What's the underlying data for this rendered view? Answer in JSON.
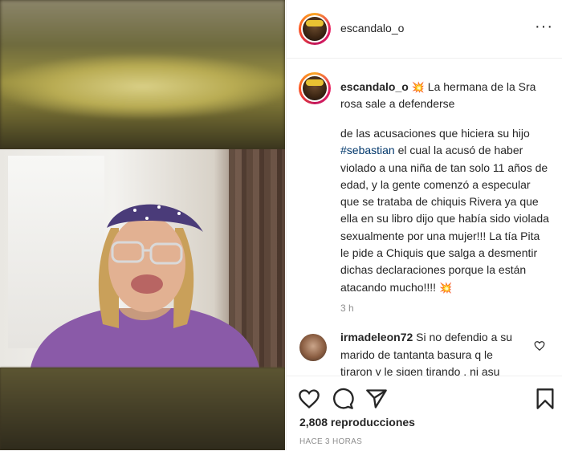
{
  "post": {
    "username": "escandalo_o",
    "more_label": "···",
    "caption_lead": "La hermana de la Sra rosa sale a defenderse",
    "caption_body_1": "de las acusaciones que hiciera su hijo",
    "hashtag": "#sebastian",
    "caption_body_2": "el cual la acusó de haber violado a una niña de tan solo 11 años de edad, y la gente comenzó a especular que se trataba de chiquis Rivera ya que ella en su libro dijo que había sido violada sexualmente por una mujer!!! La tía Pita le pide a Chiquis que salga a desmentir dichas declaraciones porque la están atacando mucho!!!!",
    "time": "3 h",
    "emoji_name": "collision-icon"
  },
  "comment": {
    "username": "irmadeleon72",
    "text": "Si no defendio a su marido de tantanta basura q le tiraron y le sigen tirando , ni asu"
  },
  "footer": {
    "views": "2,808 reproducciones",
    "ago": "HACE 3 HORAS"
  },
  "icons": {
    "like": "heart-icon",
    "comment": "comment-icon",
    "share": "share-icon",
    "save": "bookmark-icon"
  },
  "colors": {
    "hashtag": "#00376b",
    "muted": "#8e8e8e",
    "text": "#262626",
    "avatar_ring": "#e91e63"
  }
}
